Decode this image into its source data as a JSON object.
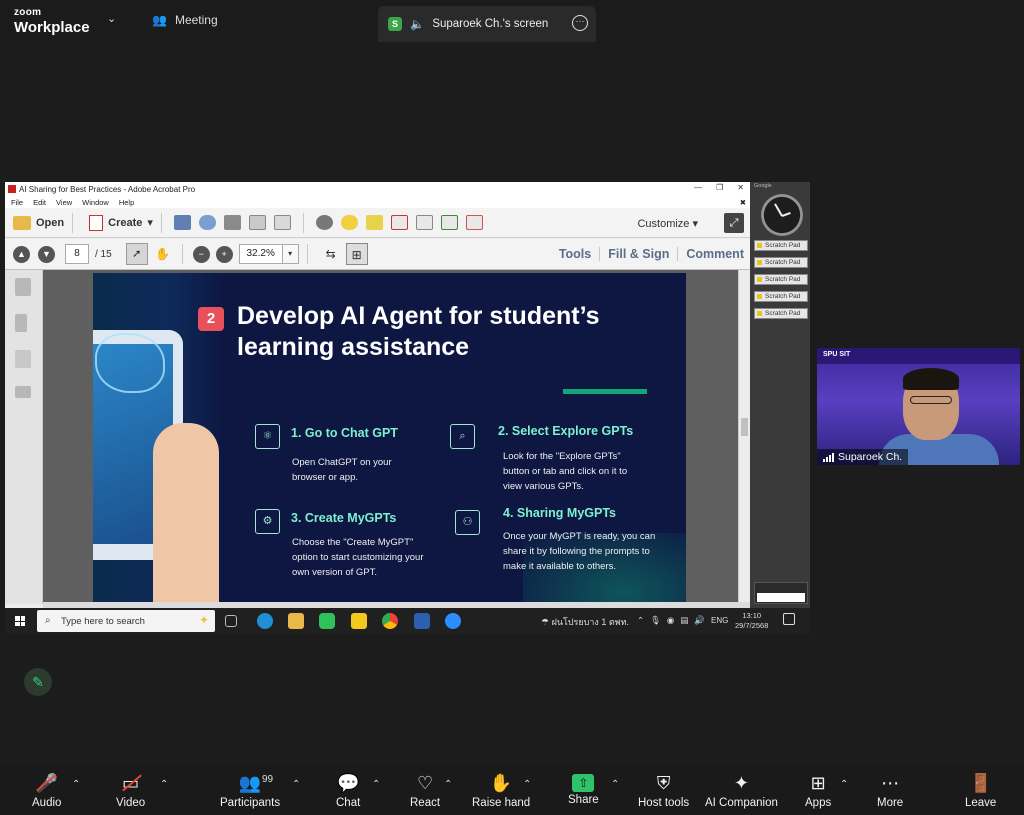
{
  "app": {
    "brand_top": "zoom",
    "brand_name": "Workplace",
    "meeting_label": "Meeting",
    "share_badge": "S",
    "share_title": "Suparoek Ch.'s screen"
  },
  "acrobat": {
    "window_title": "AI Sharing for Best Practices - Adobe Acrobat Pro",
    "menu": [
      "File",
      "Edit",
      "View",
      "Window",
      "Help"
    ],
    "open_label": "Open",
    "create_label": "Create",
    "customize_label": "Customize",
    "page_current": "8",
    "page_total": "/ 15",
    "zoom_value": "32.2%",
    "links": [
      "Tools",
      "Fill & Sign",
      "Comment"
    ]
  },
  "slide": {
    "number": "2",
    "title": "Develop AI Agent for student’s learning assistance",
    "steps": [
      {
        "heading": "1. Go to Chat GPT",
        "body": "Open ChatGPT on your browser or app."
      },
      {
        "heading": "2. Select Explore GPTs",
        "body": "Look for the \"Explore GPTs\" button or tab and click on it to view various GPTs."
      },
      {
        "heading": "3. Create MyGPTs",
        "body": "Choose the \"Create MyGPT\" option to start customizing your own version of GPT."
      },
      {
        "heading": "4. Sharing MyGPTs",
        "body": "Once your MyGPT is ready, you can share it by following the prompts to make it available to others."
      }
    ]
  },
  "gadgets": {
    "header": "Google",
    "scratch_pads": [
      "Scratch Pad",
      "Scratch Pad",
      "Scratch Pad",
      "Scratch Pad",
      "Scratch Pad"
    ]
  },
  "taskbar": {
    "search_placeholder": "Type here to search",
    "weather": "ฝนโปรยบาง 1 ตพท.",
    "lang": "ENG",
    "time": "13:10",
    "date": "29/7/2568"
  },
  "participant": {
    "name": "Suparoek Ch.",
    "banner_logo": "SPU SIT"
  },
  "controls": {
    "audio": "Audio",
    "video": "Video",
    "participants": "Participants",
    "participants_count": "99",
    "chat": "Chat",
    "react": "React",
    "raise_hand": "Raise hand",
    "share": "Share",
    "host_tools": "Host tools",
    "ai_companion": "AI Companion",
    "apps": "Apps",
    "more": "More",
    "leave": "Leave"
  },
  "colors": {
    "slide_bg": "#0d1742",
    "slide_accent": "#7ff0d0",
    "badge_red": "#e9515a",
    "share_green": "#2ec26b",
    "mute_red": "#e0433a"
  }
}
